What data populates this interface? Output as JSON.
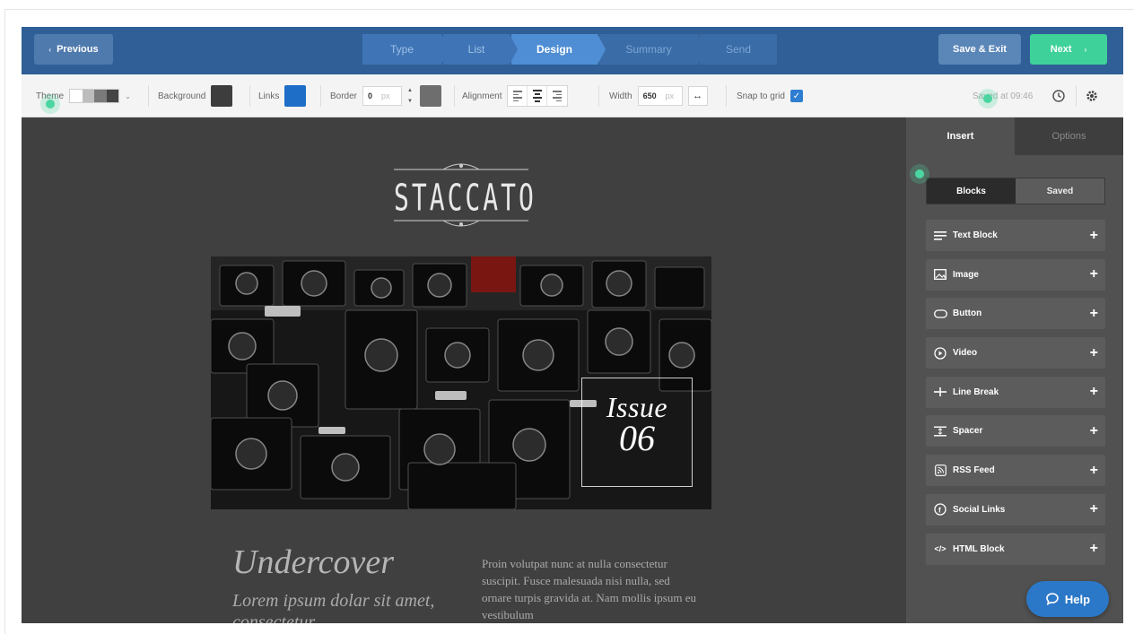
{
  "topbar": {
    "previous_label": "Previous",
    "steps": [
      {
        "label": "Type",
        "state": "done"
      },
      {
        "label": "List",
        "state": "done"
      },
      {
        "label": "Design",
        "state": "active"
      },
      {
        "label": "Summary",
        "state": "upcoming"
      },
      {
        "label": "Send",
        "state": "upcoming"
      }
    ],
    "save_exit_label": "Save & Exit",
    "next_label": "Next"
  },
  "toolbar": {
    "theme_label": "Theme",
    "background_label": "Background",
    "background_color": "#3d3d3d",
    "links_label": "Links",
    "links_color": "#1e6ec8",
    "border_label": "Border",
    "border_value": "0",
    "border_unit": "px",
    "border_color": "#6e6e6e",
    "alignment_label": "Alignment",
    "width_label": "Width",
    "width_value": "650",
    "width_unit": "px",
    "snap_label": "Snap to grid",
    "snap_checked": true,
    "saved_text": "Saved at 09:46"
  },
  "email": {
    "logo_text": "STACCATO",
    "issue_line1": "Issue",
    "issue_line2": "06",
    "headline": "Undercover",
    "subheadline": "Lorem ipsum dolar sit amet, consectetur",
    "body": "Proin volutpat nunc at nulla consectetur suscipit. Fusce malesuada nisi nulla, sed ornare turpis gravida at. Nam mollis ipsum eu vestibulum"
  },
  "panel": {
    "tabs": [
      "Insert",
      "Options"
    ],
    "segments": [
      "Blocks",
      "Saved"
    ],
    "blocks": [
      {
        "label": "Text Block",
        "icon": "text-block-icon"
      },
      {
        "label": "Image",
        "icon": "image-icon"
      },
      {
        "label": "Button",
        "icon": "button-icon"
      },
      {
        "label": "Video",
        "icon": "video-icon"
      },
      {
        "label": "Line Break",
        "icon": "line-break-icon"
      },
      {
        "label": "Spacer",
        "icon": "spacer-icon"
      },
      {
        "label": "RSS Feed",
        "icon": "rss-feed-icon"
      },
      {
        "label": "Social Links",
        "icon": "social-links-icon"
      },
      {
        "label": "HTML Block",
        "icon": "html-block-icon"
      }
    ]
  },
  "help_label": "Help",
  "colors": {
    "topbar": "#2f5f96",
    "accent_green": "#3fd19a",
    "canvas": "#404040",
    "panel": "#515151",
    "help": "#2c78c8"
  }
}
